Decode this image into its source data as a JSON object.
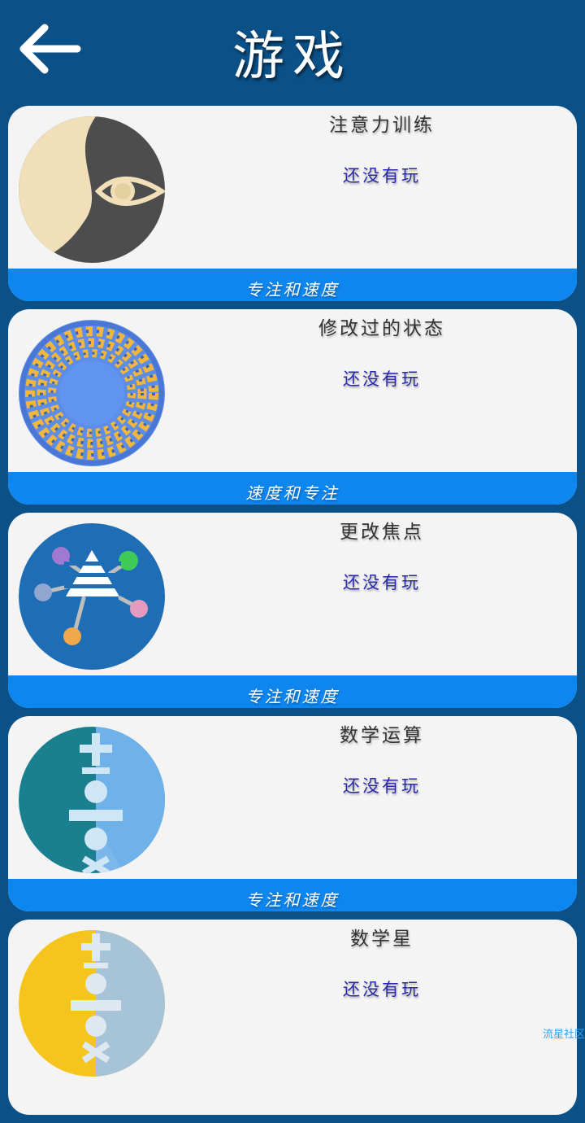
{
  "header": {
    "title": "游戏",
    "back_icon": "arrow-left-icon"
  },
  "games": [
    {
      "title": "注意力训练",
      "status": "还没有玩",
      "tags": "专注和速度",
      "icon": "eye-icon"
    },
    {
      "title": "修改过的状态",
      "status": "还没有玩",
      "tags": "速度和专注",
      "icon": "optical-illusion-circle-icon"
    },
    {
      "title": "更改焦点",
      "status": "还没有玩",
      "tags": "专注和速度",
      "icon": "pyramid-molecule-icon"
    },
    {
      "title": "数学运算",
      "status": "还没有玩",
      "tags": "专注和速度",
      "icon": "math-operators-icon"
    },
    {
      "title": "数学星",
      "status": "还没有玩",
      "tags": "",
      "icon": "math-star-icon"
    }
  ],
  "watermark": "流星社区",
  "colors": {
    "background": "#0b5188",
    "card": "#f4f4f4",
    "footer": "#0e86f0",
    "status_text": "#2a2aa8"
  }
}
